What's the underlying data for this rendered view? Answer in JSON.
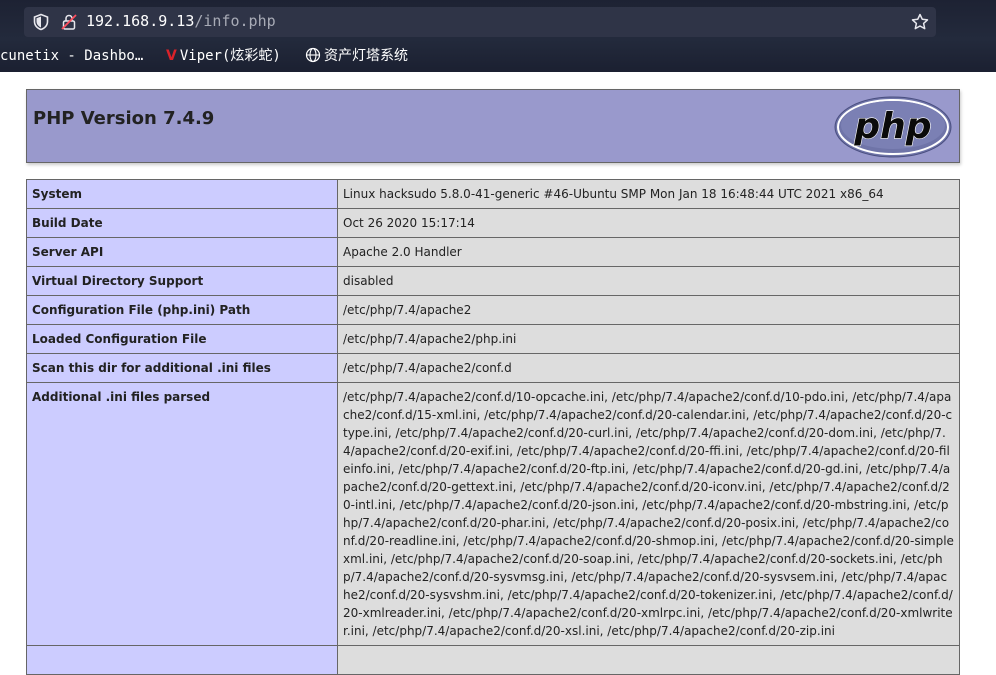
{
  "browser": {
    "url_host": "192.168.9.13",
    "url_path": "/info.php",
    "bookmarks": [
      {
        "label": "cunetix - Dashbo…"
      },
      {
        "label": "Viper(炫彩蛇)",
        "icon": "V"
      },
      {
        "label": "资产灯塔系统"
      }
    ]
  },
  "php": {
    "title": "PHP Version 7.4.9",
    "logo_text": "php"
  },
  "rows": [
    {
      "key": "System",
      "value": "Linux hacksudo 5.8.0-41-generic #46-Ubuntu SMP Mon Jan 18 16:48:44 UTC 2021 x86_64"
    },
    {
      "key": "Build Date",
      "value": "Oct 26 2020 15:17:14"
    },
    {
      "key": "Server API",
      "value": "Apache 2.0 Handler"
    },
    {
      "key": "Virtual Directory Support",
      "value": "disabled"
    },
    {
      "key": "Configuration File (php.ini) Path",
      "value": "/etc/php/7.4/apache2"
    },
    {
      "key": "Loaded Configuration File",
      "value": "/etc/php/7.4/apache2/php.ini"
    },
    {
      "key": "Scan this dir for additional .ini files",
      "value": "/etc/php/7.4/apache2/conf.d"
    },
    {
      "key": "Additional .ini files parsed",
      "value": "/etc/php/7.4/apache2/conf.d/10-opcache.ini, /etc/php/7.4/apache2/conf.d/10-pdo.ini, /etc/php/7.4/apache2/conf.d/15-xml.ini, /etc/php/7.4/apache2/conf.d/20-calendar.ini, /etc/php/7.4/apache2/conf.d/20-ctype.ini, /etc/php/7.4/apache2/conf.d/20-curl.ini, /etc/php/7.4/apache2/conf.d/20-dom.ini, /etc/php/7.4/apache2/conf.d/20-exif.ini, /etc/php/7.4/apache2/conf.d/20-ffi.ini, /etc/php/7.4/apache2/conf.d/20-fileinfo.ini, /etc/php/7.4/apache2/conf.d/20-ftp.ini, /etc/php/7.4/apache2/conf.d/20-gd.ini, /etc/php/7.4/apache2/conf.d/20-gettext.ini, /etc/php/7.4/apache2/conf.d/20-iconv.ini, /etc/php/7.4/apache2/conf.d/20-intl.ini, /etc/php/7.4/apache2/conf.d/20-json.ini, /etc/php/7.4/apache2/conf.d/20-mbstring.ini, /etc/php/7.4/apache2/conf.d/20-phar.ini, /etc/php/7.4/apache2/conf.d/20-posix.ini, /etc/php/7.4/apache2/conf.d/20-readline.ini, /etc/php/7.4/apache2/conf.d/20-shmop.ini, /etc/php/7.4/apache2/conf.d/20-simplexml.ini, /etc/php/7.4/apache2/conf.d/20-soap.ini, /etc/php/7.4/apache2/conf.d/20-sockets.ini, /etc/php/7.4/apache2/conf.d/20-sysvmsg.ini, /etc/php/7.4/apache2/conf.d/20-sysvsem.ini, /etc/php/7.4/apache2/conf.d/20-sysvshm.ini, /etc/php/7.4/apache2/conf.d/20-tokenizer.ini, /etc/php/7.4/apache2/conf.d/20-xmlreader.ini, /etc/php/7.4/apache2/conf.d/20-xmlrpc.ini, /etc/php/7.4/apache2/conf.d/20-xmlwriter.ini, /etc/php/7.4/apache2/conf.d/20-xsl.ini, /etc/php/7.4/apache2/conf.d/20-zip.ini"
    }
  ],
  "colors": {
    "header_bg": "#9999cc",
    "key_bg": "#ccccff",
    "value_bg": "#dddddd"
  }
}
